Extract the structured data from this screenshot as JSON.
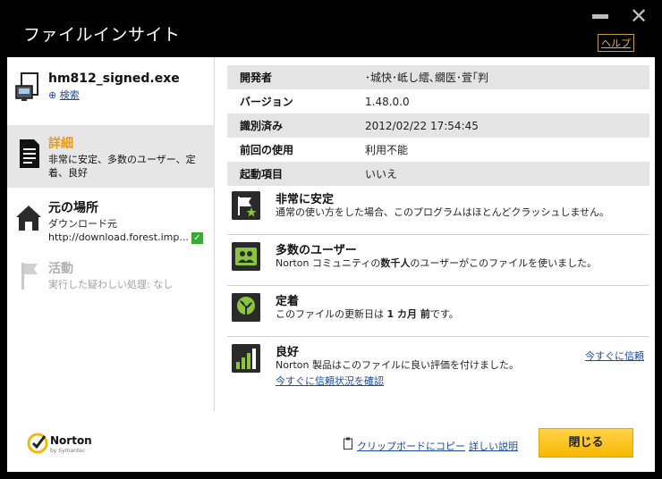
{
  "window": {
    "title": "ファイルインサイト",
    "help_label": "ヘルプ"
  },
  "sidebar": {
    "file": {
      "name": "hm812_signed.exe",
      "search_label": "検索"
    },
    "details": {
      "heading": "詳細",
      "description": "非常に安定、多数のユーザー、定着、良好"
    },
    "origin": {
      "heading": "元の場所",
      "subheading": "ダウンロード元",
      "url": "http://download.forest.imp..."
    },
    "activity": {
      "heading": "活動",
      "description": "実行した疑わしい処理: なし"
    }
  },
  "info_table": [
    {
      "label": "開発者",
      "value": "･城快･岻し繧､繝医･萓｢判"
    },
    {
      "label": "バージョン",
      "value": "1.48.0.0"
    },
    {
      "label": "識別済み",
      "value": "2012/02/22 17:54:45"
    },
    {
      "label": "前回の使用",
      "value": "利用不能"
    },
    {
      "label": "起動項目",
      "value": "いいえ"
    }
  ],
  "ratings": [
    {
      "title": "非常に安定",
      "text": "通常の使い方をした場合、このプログラムはほとんどクラッシュしません。",
      "icon": "flag-star-icon"
    },
    {
      "title": "多数のユーザー",
      "text_before": "Norton コミュニティの",
      "text_bold": "数千人",
      "text_after": "のユーザーがこのファイルを使いました。",
      "icon": "users-icon"
    },
    {
      "title": "定着",
      "text_before": "このファイルの更新日は ",
      "text_bold": "1 カ月 前",
      "text_after": "です。",
      "icon": "plant-icon"
    },
    {
      "title": "良好",
      "text": "Norton 製品はこのファイルに良い評価を付けました。",
      "trust_link": "今すぐに信頼",
      "check_link": "今すぐに信頼状況を確認",
      "icon": "signal-bars-icon"
    }
  ],
  "footer": {
    "logo_name": "Norton",
    "logo_by": "by Symantec",
    "copy_label": "クリップボードにコピー",
    "details_label": "詳しい説明",
    "close_label": "閉じる"
  },
  "colors": {
    "accent_orange": "#e89a10",
    "link_blue": "#1a4a9a",
    "check_green": "#39a935",
    "button_yellow": "#f6b800"
  }
}
